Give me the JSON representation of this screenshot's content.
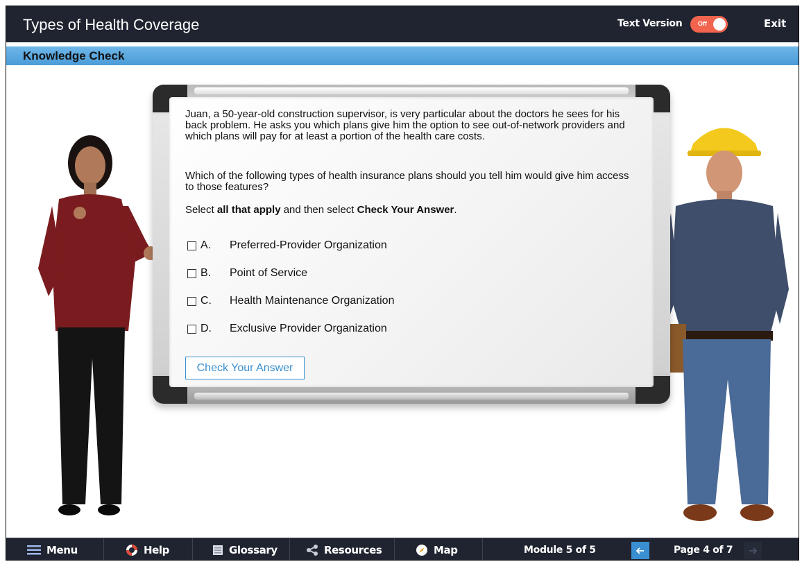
{
  "header": {
    "title": "Types of Health Coverage",
    "text_version_label": "Text Version",
    "toggle_state": "Off",
    "exit_label": "Exit"
  },
  "section": {
    "title": "Knowledge Check"
  },
  "question": {
    "paragraph1": "Juan, a 50-year-old construction supervisor, is very particular about the doctors he sees for his back problem. He asks you which plans give him the option to see out-of-network providers and which plans will pay for at least a portion of the health care costs.",
    "paragraph2": "Which of the following types of health insurance plans should you tell him would give him access to those features?",
    "instruction_prefix": "Select ",
    "instruction_bold1": "all that apply",
    "instruction_middle": " and then select ",
    "instruction_bold2": "Check Your Answer",
    "instruction_suffix": "."
  },
  "options": [
    {
      "letter": "A.",
      "text": "Preferred-Provider Organization",
      "checked": false
    },
    {
      "letter": "B.",
      "text": "Point of Service",
      "checked": false
    },
    {
      "letter": "C.",
      "text": "Health Maintenance Organization",
      "checked": false
    },
    {
      "letter": "D.",
      "text": "Exclusive Provider Organization",
      "checked": false
    }
  ],
  "check_button_label": "Check Your Answer",
  "footer": {
    "menu": "Menu",
    "help": "Help",
    "glossary": "Glossary",
    "resources": "Resources",
    "map": "Map",
    "module": "Module 5 of 5",
    "page": "Page 4 of 7"
  },
  "colors": {
    "header_bg": "#1f2430",
    "section_bar": "#4a9cd8",
    "toggle": "#f2644e",
    "accent": "#3a8fd0"
  }
}
